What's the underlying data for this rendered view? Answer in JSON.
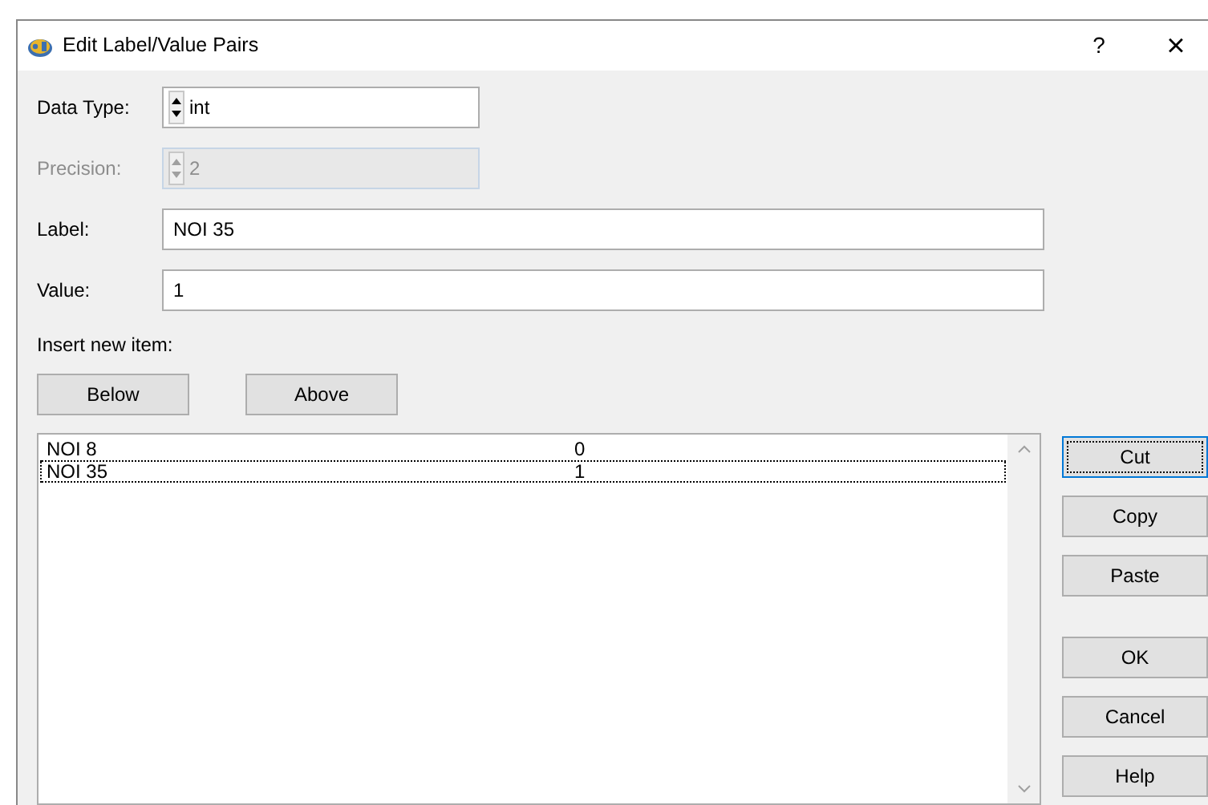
{
  "window": {
    "title": "Edit Label/Value Pairs",
    "help": "?",
    "close": "×"
  },
  "fields": [
    {
      "label": "Data Type:",
      "kind": "spin",
      "value": "int",
      "disabled": false
    },
    {
      "label": "Precision:",
      "kind": "spin",
      "value": "2",
      "disabled": true
    },
    {
      "label": "Label:",
      "kind": "text",
      "value": "NOI 35",
      "disabled": false
    },
    {
      "label": "Value:",
      "kind": "text",
      "value": "1",
      "disabled": false
    }
  ],
  "insert": {
    "caption": "Insert new item:",
    "buttons": [
      "Below",
      "Above"
    ]
  },
  "list": {
    "rows": [
      {
        "label": "NOI 8",
        "value": "0",
        "selected": false
      },
      {
        "label": "NOI 35",
        "value": "1",
        "selected": true
      }
    ]
  },
  "edit_buttons": [
    {
      "label": "Cut",
      "focused": true
    },
    {
      "label": "Copy",
      "focused": false
    },
    {
      "label": "Paste",
      "focused": false
    }
  ],
  "dialog_buttons": [
    {
      "label": "OK",
      "focused": false
    },
    {
      "label": "Cancel",
      "focused": false
    },
    {
      "label": "Help",
      "focused": false
    }
  ]
}
